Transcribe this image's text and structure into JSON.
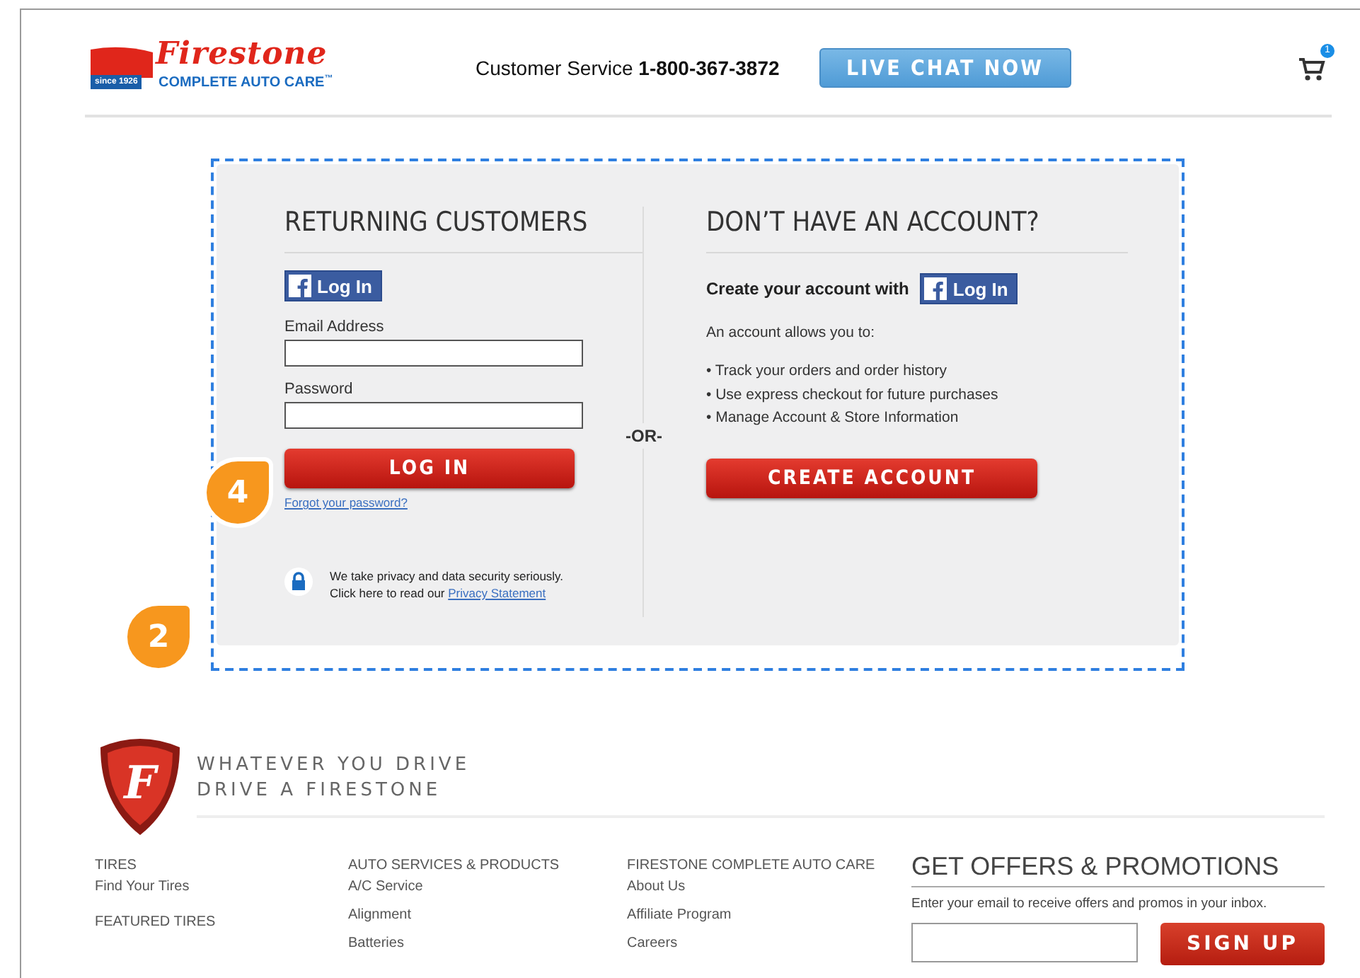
{
  "header": {
    "logo": {
      "brand": "Firestone",
      "since": "since 1926",
      "tagline": "COMPLETE AUTO CARE",
      "tm": "™"
    },
    "service_label": "Customer Service",
    "phone": "1-800-367-3872",
    "chat_button": "LIVE CHAT NOW",
    "cart_count": "1"
  },
  "login": {
    "returning": {
      "title": "RETURNING CUSTOMERS",
      "facebook_button": "Log In",
      "email_label": "Email Address",
      "password_label": "Password",
      "login_button": "LOG IN",
      "forgot_link": "Forgot your password?",
      "privacy_text": "We take privacy and data security seriously.",
      "privacy_prefix": "Click here to read our",
      "privacy_link": "Privacy Statement"
    },
    "or_label": "-OR-",
    "new_account": {
      "title": "DON’T HAVE AN ACCOUNT?",
      "create_with": "Create your account with",
      "facebook_button": "Log In",
      "intro": "An account allows you to:",
      "benefits": [
        "• Track your orders and order history",
        "• Use express checkout for future purchases",
        "• Manage Account & Store Information"
      ],
      "create_button": "CREATE ACCOUNT"
    }
  },
  "callouts": [
    {
      "label": "4"
    },
    {
      "label": "2"
    }
  ],
  "footer": {
    "shield_letter": "F",
    "slogan": [
      "WHATEVER YOU DRIVE",
      "DRIVE A FIRESTONE"
    ],
    "columns": [
      {
        "sections": [
          {
            "title": "TIRES",
            "links": [
              "Find Your Tires"
            ]
          },
          {
            "title": "FEATURED TIRES"
          }
        ]
      },
      {
        "sections": [
          {
            "title": "AUTO SERVICES & PRODUCTS",
            "links": [
              "A/C Service",
              "Alignment",
              "Batteries"
            ]
          }
        ]
      },
      {
        "sections": [
          {
            "title": "FIRESTONE COMPLETE AUTO CARE",
            "links": [
              "About Us",
              "Affiliate Program",
              "Careers"
            ]
          }
        ]
      }
    ],
    "offers": {
      "title": "GET OFFERS & PROMOTIONS",
      "text": "Enter your email to receive offers and promos in your inbox.",
      "signup_button": "SIGN UP"
    }
  }
}
